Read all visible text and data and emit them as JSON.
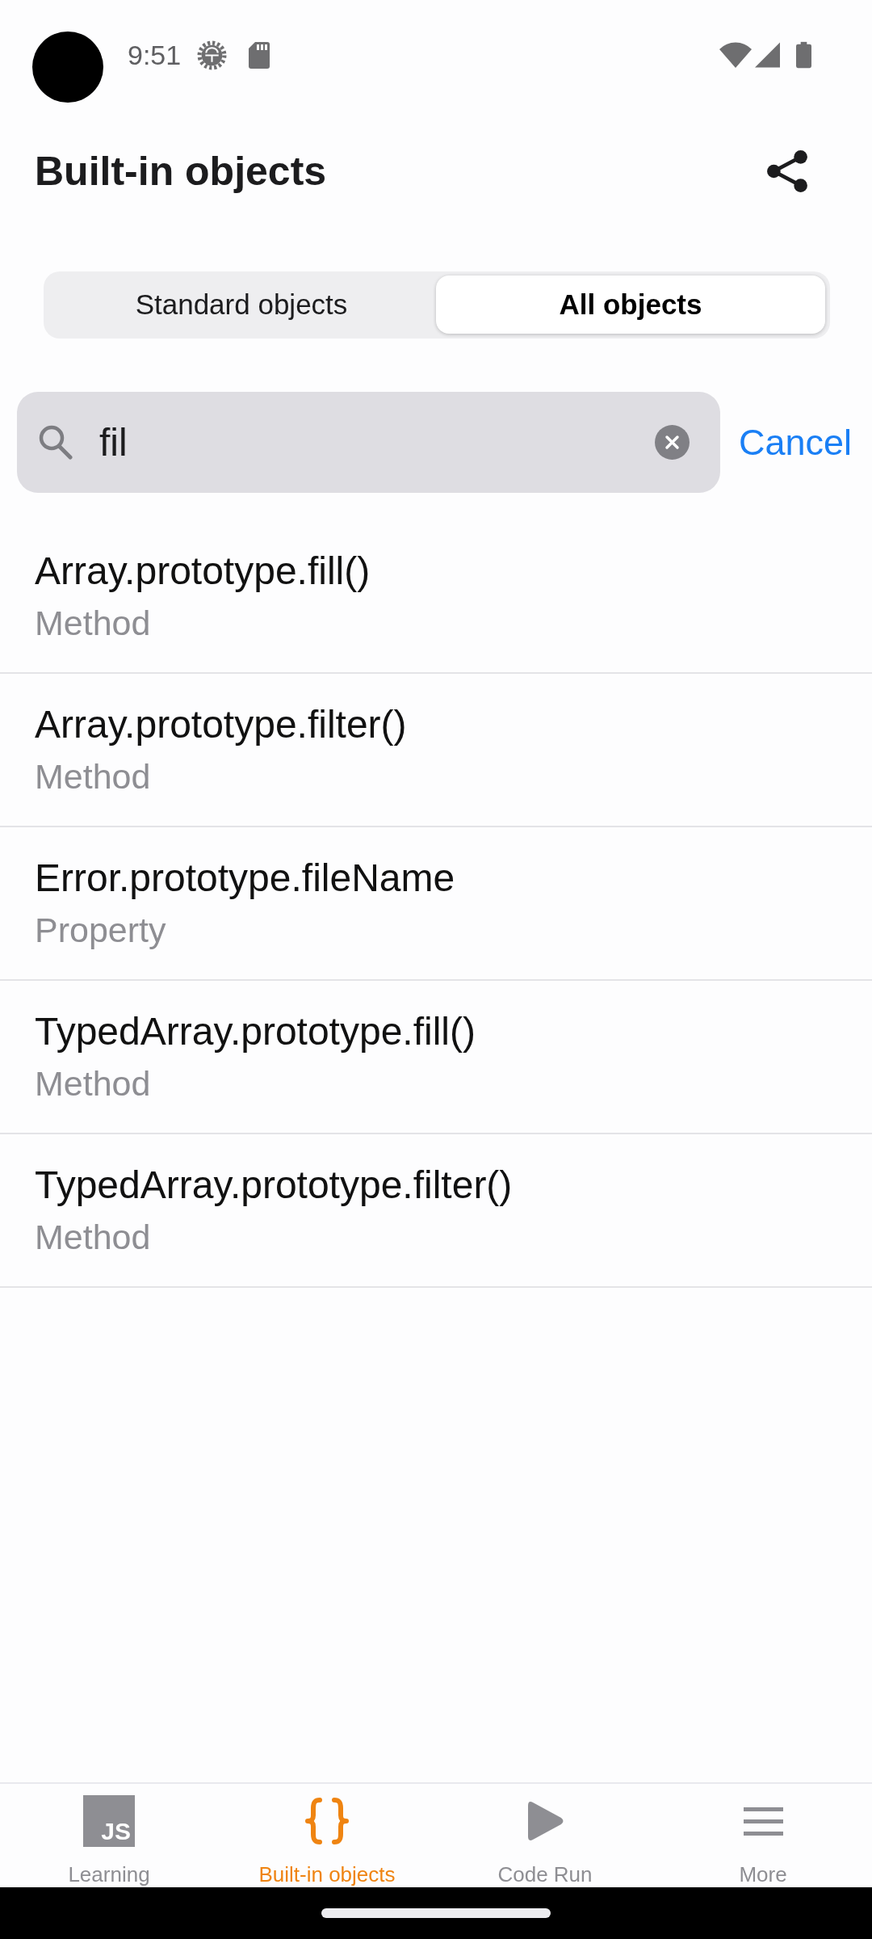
{
  "status_bar": {
    "time": "9:51"
  },
  "header": {
    "title": "Built-in objects"
  },
  "segments": [
    {
      "label": "Standard objects",
      "selected": false
    },
    {
      "label": "All objects",
      "selected": true
    }
  ],
  "search": {
    "value": "fil",
    "cancel_label": "Cancel"
  },
  "results": [
    {
      "name": "Array.prototype.fill()",
      "type": "Method"
    },
    {
      "name": "Array.prototype.filter()",
      "type": "Method"
    },
    {
      "name": "Error.prototype.fileName",
      "type": "Property"
    },
    {
      "name": "TypedArray.prototype.fill()",
      "type": "Method"
    },
    {
      "name": "TypedArray.prototype.filter()",
      "type": "Method"
    }
  ],
  "tab_bar": [
    {
      "kind": "logo",
      "logo_text": "JS",
      "label": "Learning",
      "selected": false
    },
    {
      "kind": "braces",
      "label": "Built-in objects",
      "selected": true
    },
    {
      "kind": "play",
      "label": "Code Run",
      "selected": false
    },
    {
      "kind": "menu",
      "label": "More",
      "selected": false
    }
  ]
}
